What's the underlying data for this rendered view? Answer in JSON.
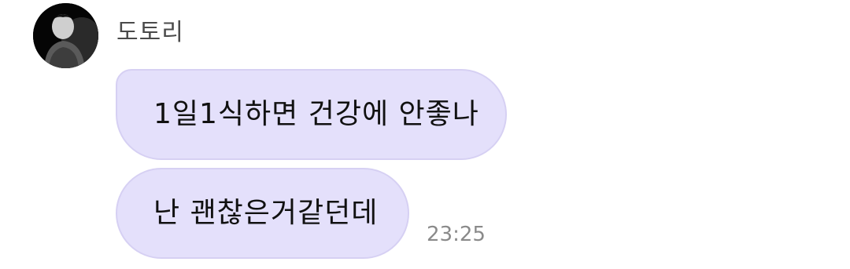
{
  "sender": {
    "name": "도토리"
  },
  "messages": [
    {
      "text": "1일1식하면 건강에 안좋나"
    },
    {
      "text": "난 괜찮은거같던데"
    }
  ],
  "timestamp": "23:25",
  "colors": {
    "bubble": "#e4e0fb",
    "bubble_border": "#d6d0f3",
    "timestamp": "#8a8a8a"
  },
  "icons": {
    "avatar": "profile-photo"
  }
}
